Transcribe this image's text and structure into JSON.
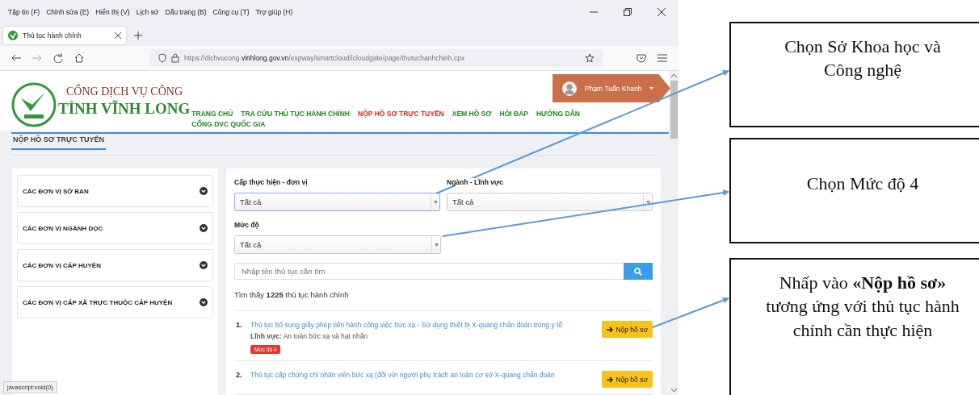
{
  "browser": {
    "menu": [
      "Tập tin (F)",
      "Chỉnh sửa (E)",
      "Hiển thị (V)",
      "Lịch sử",
      "Dấu trang (B)",
      "Công cụ (T)",
      "Trợ giúp (H)"
    ],
    "tab": {
      "title": "Thủ tục hành chính",
      "selected": true
    },
    "url": {
      "prefix": "https://dichvucong.",
      "domain": "vinhlong.gov.vn",
      "path": "/expway/smartcloud/icloudgate/page/thutuchanhchinh.cpx"
    },
    "status_text": "javascript:void(0)"
  },
  "header": {
    "logo_line_1": "CỔNG DỊCH VỤ CÔNG",
    "logo_line_2": "TỈNH VĨNH LONG",
    "user_name": "Phạm Tuấn Khanh",
    "nav": [
      {
        "label": "TRANG CHỦ",
        "selected": false
      },
      {
        "label": "TRA CỨU THỦ TỤC HÀNH CHÍNH",
        "selected": false
      },
      {
        "label": "NỘP HỒ SƠ TRỰC TUYẾN",
        "selected": true
      },
      {
        "label": "XEM HỒ SƠ",
        "selected": false
      },
      {
        "label": "HỎI ĐÁP",
        "selected": false
      },
      {
        "label": "HƯỚNG DẪN",
        "selected": false
      },
      {
        "label": "CỔNG DVC QUỐC GIA",
        "selected": false
      }
    ]
  },
  "section_title": "NỘP HỒ SƠ TRỰC TUYẾN",
  "sidebar": {
    "items": [
      "CÁC ĐƠN VỊ SỞ BAN",
      "CÁC ĐƠN VỊ NGÀNH DỌC",
      "CÁC ĐƠN VỊ CẤP HUYỆN",
      "CÁC ĐƠN VỊ CẤP XÃ TRỰC THUỘC CẤP HUYỆN"
    ]
  },
  "filters": {
    "unit": {
      "label": "Cấp thực hiện - đơn vị",
      "value": "Tất cả"
    },
    "field": {
      "label": "Ngành - Lĩnh vực",
      "value": "Tất cả"
    },
    "level": {
      "label": "Mức độ",
      "value": "Tất cả"
    },
    "search": {
      "placeholder": "Nhập tên thủ tục cần tìm"
    }
  },
  "result_count": "Tìm thấy **1225** thủ tục hành chính",
  "results": [
    {
      "number": "1.",
      "title": "Thủ tục bổ sung giấy phép tiến hành công việc bức xạ - Sử dụng thiết bị X-quang chẩn đoán trong y tế",
      "field": "**Lĩnh vực:** An toàn bức xạ và hạt nhân",
      "badge": "Mức độ 4",
      "button": "Nộp hồ sơ"
    },
    {
      "number": "2.",
      "title": "Thủ tục cấp chứng chỉ nhân viên bức xạ (đối với người phụ trách an toàn cơ sở X-quang chẩn đoán",
      "button": "Nộp hồ sơ"
    }
  ],
  "callouts": [
    "Chọn Sở Khoa học và Công nghệ",
    "Chọn Mức độ 4",
    "Nhấp vào **«Nộp hồ sơ»** tương ứng với thủ tục hành chính cần thực hiện"
  ]
}
